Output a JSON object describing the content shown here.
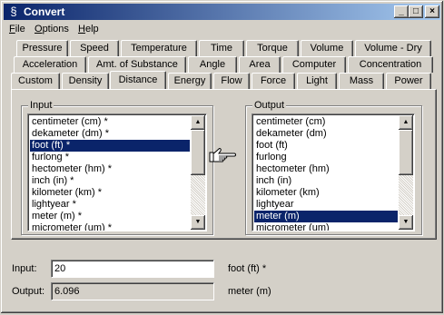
{
  "window": {
    "title": "Convert",
    "icon": "convert-app-icon",
    "buttons": {
      "minimize": "_",
      "maximize": "□",
      "close": "×"
    }
  },
  "menu": {
    "items": [
      {
        "label": "File"
      },
      {
        "label": "Options"
      },
      {
        "label": "Help"
      }
    ]
  },
  "tabs": {
    "row1": [
      "Pressure",
      "Speed",
      "Temperature",
      "Time",
      "Torque",
      "Volume",
      "Volume - Dry"
    ],
    "row2": [
      "Acceleration",
      "Amt. of Substance",
      "Angle",
      "Area",
      "Computer",
      "Concentration"
    ],
    "row3": [
      "Custom",
      "Density",
      "Distance",
      "Energy",
      "Flow",
      "Force",
      "Light",
      "Mass",
      "Power"
    ],
    "selected": "Distance"
  },
  "input_group": {
    "label": "Input",
    "items": [
      "centimeter (cm) *",
      "dekameter (dm) *",
      "foot (ft) *",
      "furlong *",
      "hectometer (hm) *",
      "inch (in) *",
      "kilometer (km) *",
      "lightyear *",
      "meter (m) *",
      "micrometer (um) *"
    ],
    "selected_index": 2
  },
  "output_group": {
    "label": "Output",
    "items": [
      "centimeter (cm)",
      "dekameter (dm)",
      "foot (ft)",
      "furlong",
      "hectometer (hm)",
      "inch (in)",
      "kilometer (km)",
      "lightyear",
      "meter (m)",
      "micrometer (um)"
    ],
    "selected_index": 8
  },
  "arrow_icon": "pointing-hand-icon",
  "fields": {
    "input_label": "Input:",
    "input_value": "20",
    "input_unit": "foot (ft) *",
    "output_label": "Output:",
    "output_value": "6.096",
    "output_unit": "meter (m)"
  },
  "colors": {
    "titlebar_start": "#0a246a",
    "titlebar_end": "#a6caf0",
    "selection": "#0a246a",
    "face": "#d4d0c8"
  }
}
